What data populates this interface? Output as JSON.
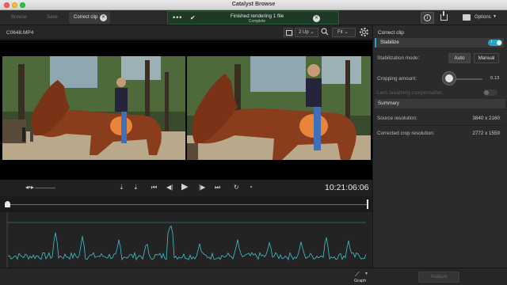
{
  "window": {
    "title": "Catalyst Browse"
  },
  "toolbar": {
    "tabs": [
      {
        "label": "Browse"
      },
      {
        "label": "Save"
      },
      {
        "label": "Correct clip"
      }
    ],
    "notification": {
      "message": "Finished rendering 1 file",
      "status": "Complete"
    },
    "options_label": "Options"
  },
  "viewer": {
    "clip_name": "C0648.MP4",
    "layout_select": "2 Up",
    "zoom_select": "Fit"
  },
  "transport": {
    "timecode": "10:21:06:06"
  },
  "graph": {
    "label": "Graph",
    "accent_color": "#3fc2d0"
  },
  "panel": {
    "title": "Correct clip",
    "stabilize": {
      "label": "Stabilize",
      "toggle_text": "I",
      "enabled": true,
      "accent_color": "#2aa3c9"
    },
    "stabilization_mode": {
      "label": "Stabilization mode:",
      "options": [
        "Auto",
        "Manual"
      ],
      "selected": "Auto"
    },
    "cropping_amount": {
      "label": "Cropping amount:",
      "value": "0.13"
    },
    "lens_compensation": {
      "label": "Lens breathing compensation",
      "enabled": false
    },
    "summary": {
      "header": "Summary",
      "source_resolution": {
        "label": "Source resolution:",
        "value": "3840 x 2160"
      },
      "corrected_resolution": {
        "label": "Corrected crop resolution:",
        "value": "2772 x 1559"
      }
    }
  },
  "footer": {
    "analyze_label": "Analyze"
  }
}
